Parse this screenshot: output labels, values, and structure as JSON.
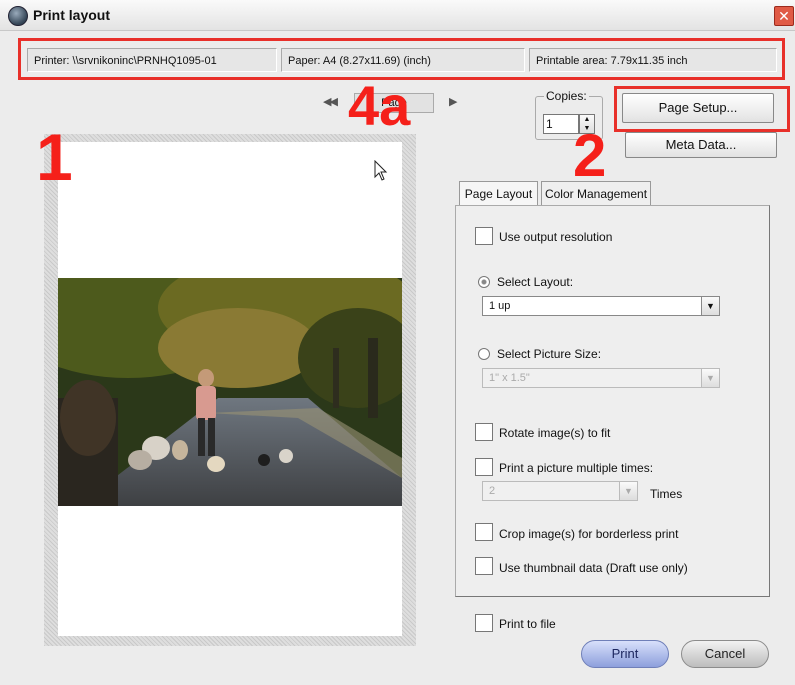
{
  "window": {
    "title": "Print layout",
    "close_glyph": "✕"
  },
  "info": {
    "printer": "Printer:  \\\\srvnikoninc\\PRNHQ1095-01",
    "paper": "Paper:  A4 (8.27x11.69) (inch)",
    "printable": "Printable area:  7.79x11.35 inch"
  },
  "pager": {
    "prev_glyph": "◀◀",
    "label": "Page",
    "next_glyph": "▶"
  },
  "copies": {
    "label": "Copies:",
    "value": "1"
  },
  "buttons": {
    "page_setup": "Page Setup...",
    "meta_data": "Meta Data...",
    "print": "Print",
    "cancel": "Cancel"
  },
  "tabs": [
    {
      "label": "Page Layout"
    },
    {
      "label": "Color Management"
    }
  ],
  "options": {
    "use_output_resolution": "Use output resolution",
    "select_layout": "Select Layout:",
    "layout_value": "1 up",
    "select_picture_size": "Select Picture Size:",
    "picture_size_value": "1\" x 1.5\"",
    "rotate": "Rotate image(s) to fit",
    "multiple": "Print a picture multiple times:",
    "times_value": "2",
    "times_label": "Times",
    "crop": "Crop image(s) for borderless print",
    "thumbnail": "Use thumbnail data (Draft use only)",
    "print_to_file": "Print to file"
  },
  "annotations": {
    "one": "1",
    "two": "2",
    "four_a": "4a"
  },
  "colors": {
    "annotation_red": "#e8302a",
    "print_button": "#9fb0e6",
    "cancel_button": "#c9c9c9"
  },
  "icons": [
    "app-icon",
    "close-icon",
    "prev-page-icon",
    "next-page-icon",
    "mouse-cursor-icon",
    "dropdown-arrow-icon",
    "spinner-icon"
  ]
}
